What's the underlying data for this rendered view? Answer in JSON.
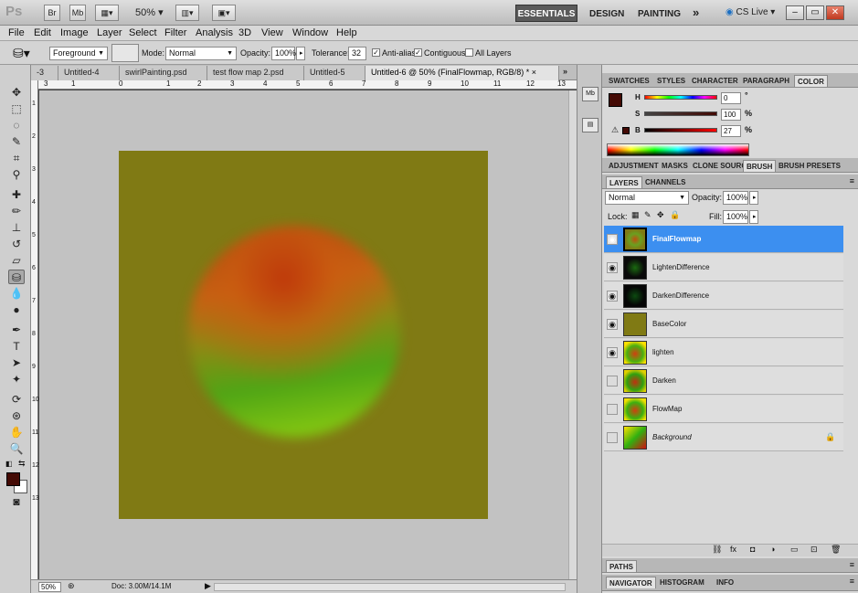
{
  "app": {
    "logo": "Ps",
    "zoom": "50%",
    "zoom_caret": "▾"
  },
  "appbar": {
    "btn_bridge": "Br",
    "btn_minibridge": "Mb",
    "workspaces": {
      "active": "ESSENTIALS",
      "design": "DESIGN",
      "painting": "PAINTING",
      "more": "»"
    },
    "cslive": "CS Live",
    "window": {
      "minimize": "–",
      "restore": "▭",
      "close": "✕"
    }
  },
  "menu": [
    "File",
    "Edit",
    "Image",
    "Layer",
    "Select",
    "Filter",
    "Analysis",
    "3D",
    "View",
    "Window",
    "Help"
  ],
  "options": {
    "fill_source": "Foreground",
    "mode_label": "Mode:",
    "mode": "Normal",
    "opacity_label": "Opacity:",
    "opacity": "100%",
    "tolerance_label": "Tolerance:",
    "tolerance": "32",
    "antialias": "Anti-alias",
    "contiguous": "Contiguous",
    "all_layers": "All Layers"
  },
  "doctabs": [
    {
      "label": "-3"
    },
    {
      "label": "Untitled-4"
    },
    {
      "label": "swirlPainting.psd"
    },
    {
      "label": "test flow map 2.psd"
    },
    {
      "label": "Untitled-5"
    },
    {
      "label": "Untitled-6 @ 50% (FinalFlowmap, RGB/8) *",
      "active": true
    }
  ],
  "tab_close": "×",
  "tab_overflow": "»",
  "ruler": {
    "h": [
      "3",
      "1",
      "0",
      "1",
      "2",
      "3",
      "4",
      "5",
      "6",
      "7",
      "8",
      "9",
      "10",
      "11",
      "12",
      "13"
    ],
    "v": [
      "1",
      "2",
      "3",
      "4",
      "5",
      "6",
      "7",
      "8",
      "9",
      "10",
      "11",
      "12",
      "13"
    ]
  },
  "status": {
    "zoom": "50%",
    "doc": "Doc: 3.00M/14.1M"
  },
  "colors": {
    "base": "#807a14",
    "foreground": "#440a04",
    "background": "#ffffff",
    "selection": "#3c8ff0"
  },
  "color_panel": {
    "tabs": [
      "SWATCHES",
      "STYLES",
      "CHARACTER",
      "PARAGRAPH",
      "COLOR"
    ],
    "h_label": "H",
    "h": "0",
    "h_unit": "°",
    "s_label": "S",
    "s": "100",
    "s_unit": "%",
    "b_label": "B",
    "b": "27",
    "b_unit": "%"
  },
  "adjust_tabs": [
    "ADJUSTMENT",
    "MASKS",
    "CLONE SOURCE",
    "BRUSH",
    "BRUSH PRESETS"
  ],
  "layers_panel": {
    "tabs": [
      "LAYERS",
      "CHANNELS"
    ],
    "blend": "Normal",
    "opacity_label": "Opacity:",
    "opacity": "100%",
    "lock_label": "Lock:",
    "fill_label": "Fill:",
    "fill": "100%",
    "layers": [
      {
        "name": "FinalFlowmap",
        "visible": true,
        "selected": true
      },
      {
        "name": "LightenDifference",
        "visible": true
      },
      {
        "name": "DarkenDifference",
        "visible": true
      },
      {
        "name": "BaseColor",
        "visible": true
      },
      {
        "name": "lighten",
        "visible": true
      },
      {
        "name": "Darken",
        "visible": false
      },
      {
        "name": "FlowMap",
        "visible": false
      },
      {
        "name": "Background",
        "visible": false,
        "locked": true
      }
    ]
  },
  "bottom_tabs": {
    "paths": "PATHS",
    "nav": [
      "NAVIGATOR",
      "HISTOGRAM",
      "INFO"
    ]
  }
}
